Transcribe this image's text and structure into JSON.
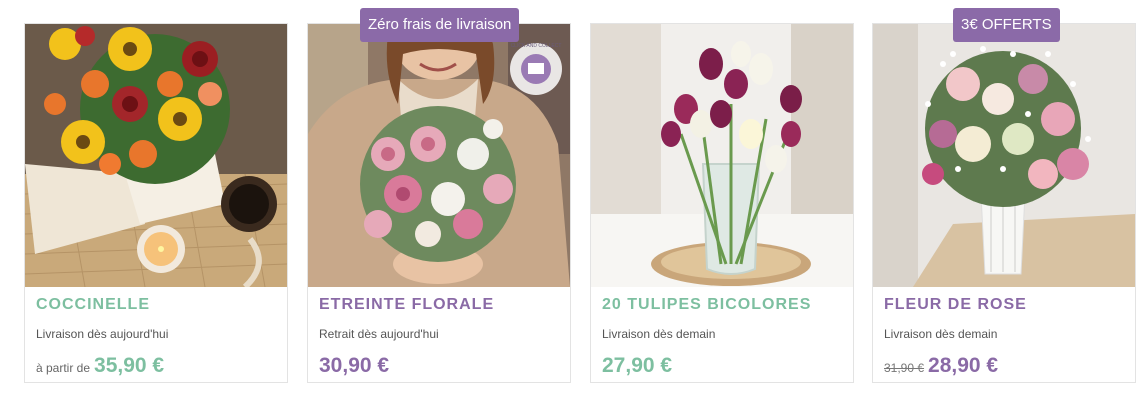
{
  "products": [
    {
      "name": "COCCINELLE",
      "delivery": "Livraison dès aujourd'hui",
      "from_label": "à partir de",
      "price": "35,90 €"
    },
    {
      "badge": "Zéro frais de livraison",
      "name": "ETREINTE FLORALE",
      "delivery": "Retrait dès aujourd'hui",
      "price": "30,90 €",
      "photo_stamp": "CLICK AND COLLECT"
    },
    {
      "name": "20 TULIPES BICOLORES",
      "delivery": "Livraison dès demain",
      "price": "27,90 €"
    },
    {
      "badge": "3€ OFFERTS",
      "name": "FLEUR DE ROSE",
      "delivery": "Livraison dès demain",
      "old_price": "31,90 €",
      "price": "28,90 €"
    }
  ],
  "colors": {
    "badge": "#8b6aa8",
    "green": "#7dbfa0",
    "purple": "#8a6aa6"
  }
}
